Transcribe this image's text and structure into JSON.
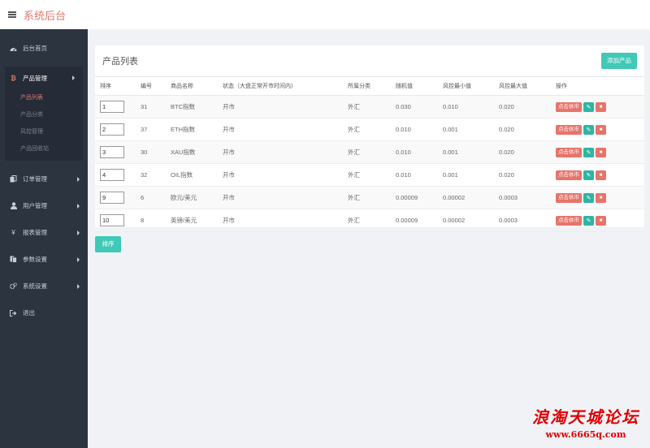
{
  "app": {
    "title": "系统后台"
  },
  "sidebar": {
    "items": [
      {
        "label": "后台首页",
        "icon": "dashboard-icon"
      },
      {
        "label": "产品管理",
        "icon": "bitcoin-icon",
        "expanded": true,
        "children": [
          {
            "label": "产品列表",
            "active": true
          },
          {
            "label": "产品分类"
          },
          {
            "label": "风控管理"
          },
          {
            "label": "产品回收站"
          }
        ]
      },
      {
        "label": "订单管理",
        "icon": "copy-icon"
      },
      {
        "label": "用户管理",
        "icon": "user-icon"
      },
      {
        "label": "报表管理",
        "icon": "yen-icon"
      },
      {
        "label": "参数设置",
        "icon": "files-icon"
      },
      {
        "label": "系统设置",
        "icon": "cogs-icon"
      },
      {
        "label": "退出",
        "icon": "sign-out-icon"
      }
    ]
  },
  "panel": {
    "title": "产品列表",
    "add_button": "添加产品",
    "sort_button": "排序"
  },
  "table": {
    "headers": [
      "排序",
      "编号",
      "商品名称",
      "状态（大盘正常开市时间内）",
      "所属分类",
      "随机值",
      "风控最小值",
      "风控最大值",
      "操作"
    ],
    "rows": [
      {
        "sort": "1",
        "id": "31",
        "name": "BTC指数",
        "status": "开市",
        "category": "外汇",
        "random": "0.030",
        "min": "0.010",
        "max": "0.020",
        "action": "点击休市"
      },
      {
        "sort": "2",
        "id": "37",
        "name": "ETH指数",
        "status": "开市",
        "category": "外汇",
        "random": "0.010",
        "min": "0.001",
        "max": "0.020",
        "action": "点击休市"
      },
      {
        "sort": "3",
        "id": "30",
        "name": "XAU指数",
        "status": "开市",
        "category": "外汇",
        "random": "0.010",
        "min": "0.001",
        "max": "0.020",
        "action": "点击休市"
      },
      {
        "sort": "4",
        "id": "32",
        "name": "OIL指数",
        "status": "开市",
        "category": "外汇",
        "random": "0.010",
        "min": "0.001",
        "max": "0.020",
        "action": "点击休市"
      },
      {
        "sort": "9",
        "id": "6",
        "name": "欧元/美元",
        "status": "开市",
        "category": "外汇",
        "random": "0.00009",
        "min": "0.00002",
        "max": "0.0003",
        "action": "点击休市"
      },
      {
        "sort": "10",
        "id": "8",
        "name": "英镑/美元",
        "status": "开市",
        "category": "外汇",
        "random": "0.00009",
        "min": "0.00002",
        "max": "0.0003",
        "action": "点击休市"
      }
    ]
  },
  "watermark": {
    "line1": "浪淘天城论坛",
    "line2": "www.6665q.com"
  },
  "colors": {
    "accent": "#e2786c",
    "teal": "#3fc9b6",
    "sidebar_bg": "#2c3440",
    "danger": "#e8736a"
  }
}
